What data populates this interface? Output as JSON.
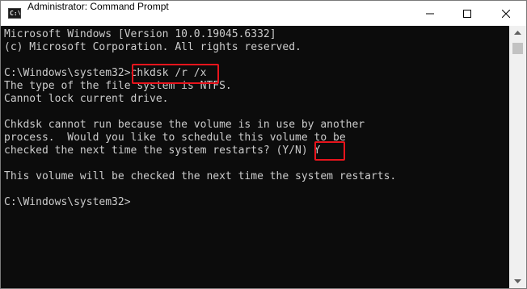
{
  "window": {
    "title": "Administrator: Command Prompt",
    "app_icon_text": "C:\\",
    "icons": {
      "app": "command-prompt-icon",
      "minimize": "minimize-icon",
      "maximize": "maximize-icon",
      "close": "close-icon"
    }
  },
  "console": {
    "lines": [
      "Microsoft Windows [Version 10.0.19045.6332]",
      "(c) Microsoft Corporation. All rights reserved.",
      "",
      "C:\\Windows\\system32>chkdsk /r /x",
      "The type of the file system is NTFS.",
      "Cannot lock current drive.",
      "",
      "Chkdsk cannot run because the volume is in use by another",
      "process.  Would you like to schedule this volume to be",
      "checked the next time the system restarts? (Y/N) Y",
      "",
      "This volume will be checked the next time the system restarts.",
      "",
      "C:\\Windows\\system32>"
    ]
  },
  "colors": {
    "console_bg": "#0c0c0c",
    "console_text": "#cccccc",
    "highlight_border": "#e8141c"
  }
}
